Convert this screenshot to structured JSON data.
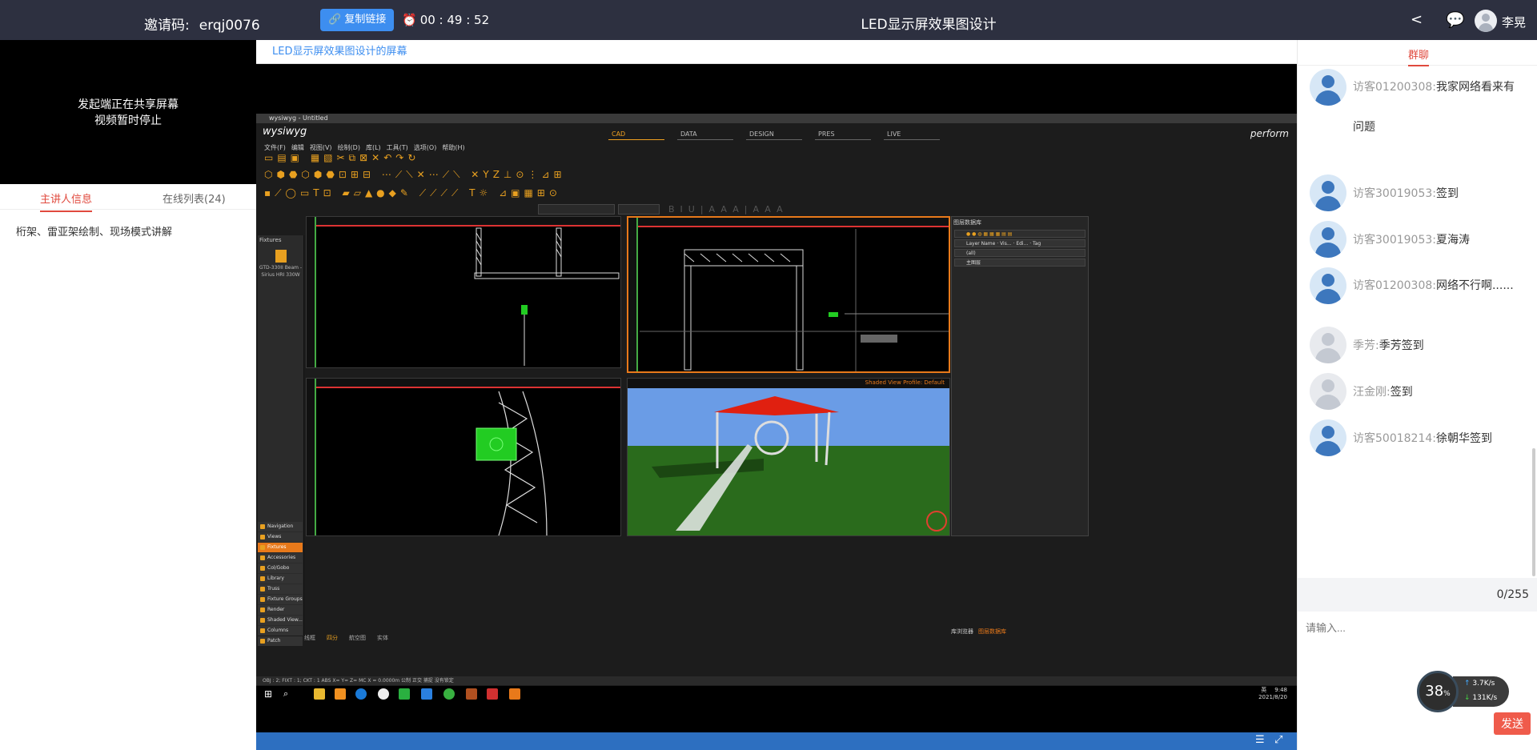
{
  "header": {
    "invite_label": "邀请码:",
    "invite_code": "erqj0076",
    "copy_label": "复制链接",
    "timer": "00 : 49 : 52",
    "title": "LED显示屏效果图设计",
    "user": "李晃"
  },
  "left": {
    "video_status_line1": "发起端正在共享屏幕",
    "video_status_line2": "视频暂时停止",
    "tabs": [
      "主讲人信息",
      "在线列表(24)"
    ],
    "description": "桁架、雷亚架绘制、现场模式讲解"
  },
  "screen": {
    "title": "LED显示屏效果图设计的屏幕"
  },
  "app": {
    "window_title": "wysiwyg - Untitled",
    "brand": "wysiwyg",
    "perform": "perform",
    "modes": [
      "CAD",
      "DATA",
      "DESIGN",
      "PRES",
      "LIVE"
    ],
    "menu": [
      "文件(F)",
      "编辑",
      "视图(V)",
      "绘制(D)",
      "库(L)",
      "工具(T)",
      "选项(O)",
      "帮助(H)"
    ],
    "fixtures_header": "Fixtures",
    "fixture_name": "GTD-330II Beam - Sirius HRI 330W",
    "side_items": [
      "Navigation",
      "Views",
      "Fixtures",
      "Accessories",
      "Col/Gobo",
      "Library",
      "Truss",
      "Fixture Groups",
      "Render",
      "Shaded View...",
      "Columns",
      "Patch"
    ],
    "shaded_label": "Shaded View Profile: Default",
    "layers_header": "图层数据库",
    "layer_cols": [
      "Layer Name",
      "Vis...",
      "Edi...",
      "Tag"
    ],
    "layer_all": "(all)",
    "layer_main": "主图层",
    "bottom_tabs": [
      "库浏览器",
      "图层数据库"
    ],
    "view_tabs": [
      "线框",
      "四分",
      "航空图",
      "实体"
    ],
    "status": "OBJ : 2; FIXT : 1; CKT : 1      ABS  X=      Y=      Z=      MC X = 0.0000m   公制  正交  捕捉  没有锁定",
    "taskbar_time": "9:48",
    "taskbar_date": "2021/8/20",
    "taskbar_lang": "英"
  },
  "chat": {
    "tab": "群聊",
    "messages": [
      {
        "name": "访客01200308:",
        "text": "我家网络看来有问题",
        "gray": false
      },
      {
        "name": "访客30019053:",
        "text": "签到",
        "gray": false
      },
      {
        "name": "访客30019053:",
        "text": "夏海涛",
        "gray": false
      },
      {
        "name": "访客01200308:",
        "text": "网络不行啊......",
        "gray": false
      },
      {
        "name": "季芳:",
        "text": "季芳签到",
        "gray": true
      },
      {
        "name": "汪金刚:",
        "text": "签到",
        "gray": true
      },
      {
        "name": "访客50018214:",
        "text": "徐朝华签到",
        "gray": false
      }
    ],
    "counter": "0/255",
    "placeholder": "请输入...",
    "send": "发送",
    "speed_pct": "38",
    "speed_pct_unit": "%",
    "upload": "3.7",
    "download": "131",
    "speed_unit": "K/s"
  }
}
